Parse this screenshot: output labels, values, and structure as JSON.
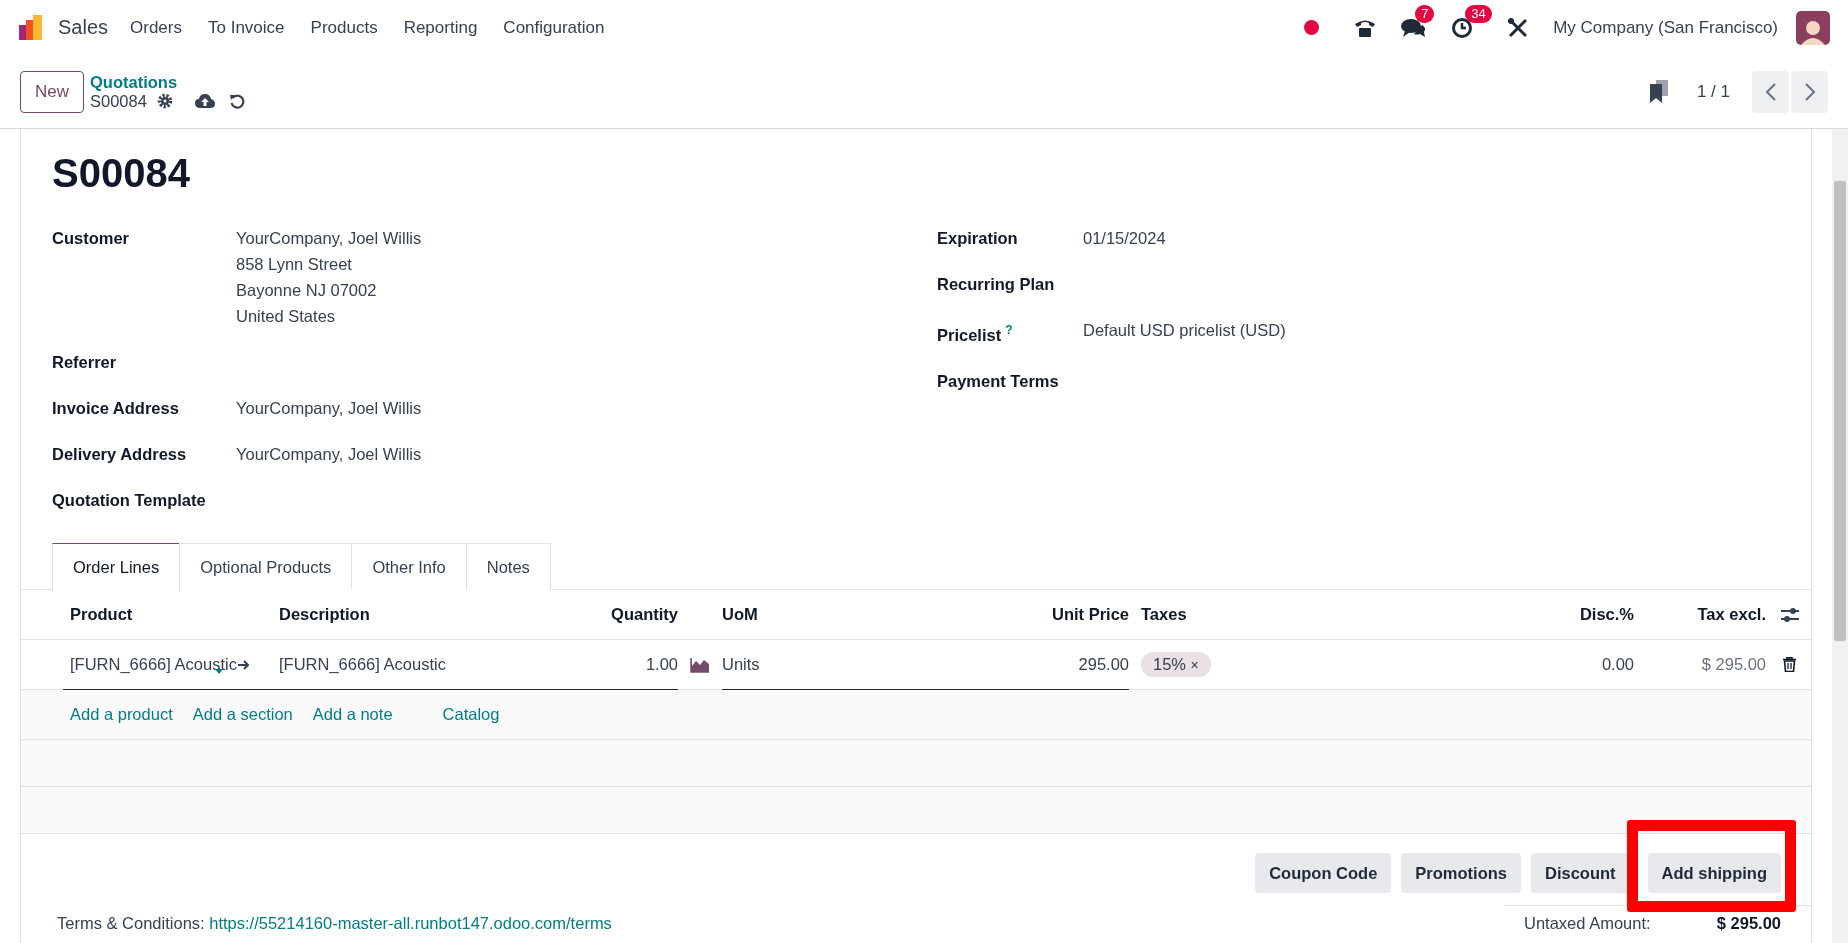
{
  "navbar": {
    "app": "Sales",
    "menu": [
      "Orders",
      "To Invoice",
      "Products",
      "Reporting",
      "Configuration"
    ],
    "messages_badge": "7",
    "activities_badge": "34",
    "company": "My Company (San Francisco)"
  },
  "control_panel": {
    "new_button": "New",
    "breadcrumb": "Quotations",
    "record": "S00084",
    "pager": "1 / 1"
  },
  "form": {
    "title": "S00084",
    "left_fields": [
      {
        "label": "Customer",
        "lines": [
          "YourCompany, Joel Willis",
          "858 Lynn Street",
          "Bayonne NJ 07002",
          "United States"
        ]
      },
      {
        "label": "Referrer"
      },
      {
        "label": "Invoice Address",
        "lines": [
          "YourCompany, Joel Willis"
        ]
      },
      {
        "label": "Delivery Address",
        "lines": [
          "YourCompany, Joel Willis"
        ]
      },
      {
        "label": "Quotation Template"
      }
    ],
    "right_fields": [
      {
        "label": "Expiration",
        "lines": [
          "01/15/2024"
        ]
      },
      {
        "label": "Recurring Plan"
      },
      {
        "label": "Pricelist",
        "help": "?",
        "lines": [
          "Default USD pricelist (USD)"
        ]
      },
      {
        "label": "Payment Terms"
      }
    ]
  },
  "tabs": [
    {
      "label": "Order Lines",
      "selected": true
    },
    {
      "label": "Optional Products",
      "selected": false
    },
    {
      "label": "Other Info",
      "selected": false
    },
    {
      "label": "Notes",
      "selected": false
    }
  ],
  "order_lines": {
    "columns": [
      "Product",
      "Description",
      "Quantity",
      "UoM",
      "Unit Price",
      "Taxes",
      "Disc.%",
      "Tax excl."
    ],
    "rows": [
      {
        "product": "[FURN_6666] Acoustic",
        "description": "[FURN_6666] Acoustic",
        "quantity": "1.00",
        "uom": "Units",
        "unit_price": "295.00",
        "taxes": [
          {
            "label": "15%",
            "remove": "×"
          }
        ],
        "discount": "0.00",
        "subtotal": "$ 295.00"
      }
    ],
    "add_links": [
      "Add a product",
      "Add a section",
      "Add a note",
      "Catalog"
    ]
  },
  "actions": [
    {
      "label": "Coupon Code",
      "highlighted": false
    },
    {
      "label": "Promotions",
      "highlighted": false
    },
    {
      "label": "Discount",
      "highlighted": false
    },
    {
      "label": "Add shipping",
      "highlighted": true
    }
  ],
  "terms": {
    "label": "Terms & Conditions:",
    "link": "https://55214160-master-all.runbot147.odoo.com/terms"
  },
  "totals": [
    {
      "label": "Untaxed Amount:",
      "value": "$ 295.00"
    }
  ]
}
